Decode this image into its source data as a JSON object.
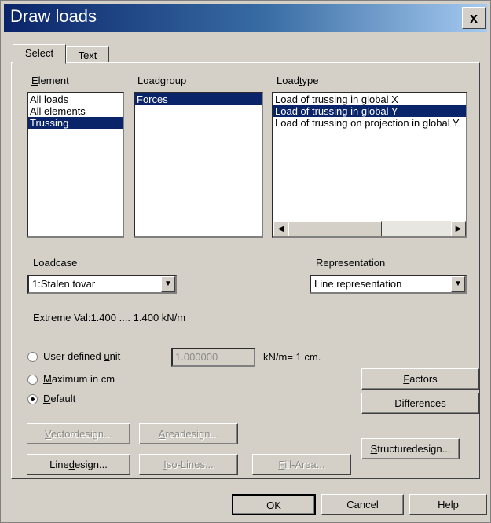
{
  "window": {
    "title": "Draw loads",
    "close_label": "x"
  },
  "tabs": [
    {
      "label": "Select",
      "active": true
    },
    {
      "label": "Text",
      "active": false
    }
  ],
  "element": {
    "label": "Element",
    "items": [
      {
        "label": "All loads",
        "selected": false
      },
      {
        "label": "All elements",
        "selected": false
      },
      {
        "label": "Trussing",
        "selected": true
      }
    ]
  },
  "loadgroup": {
    "label": "Loadgroup",
    "items": [
      {
        "label": "Forces",
        "selected": true
      }
    ]
  },
  "loadtype": {
    "label": "Loadtype",
    "items": [
      {
        "label": "Load of trussing in global X",
        "selected": false
      },
      {
        "label": "Load of trussing in global Y",
        "selected": true
      },
      {
        "label": "Load of trussing on projection in global Y",
        "selected": false
      }
    ],
    "scroll_left_icon": "left-arrow-icon",
    "scroll_right_icon": "right-arrow-icon"
  },
  "loadcase": {
    "label": "Loadcase",
    "value": "1:Stalen tovar"
  },
  "representation": {
    "label": "Representation",
    "value": "Line representation"
  },
  "extreme_text": "Extreme Val:1.400 .... 1.400  kN/m",
  "scale": {
    "options": [
      {
        "label": "User defined unit",
        "checked": false
      },
      {
        "label": "Maximum in cm",
        "checked": false
      },
      {
        "label": "Default",
        "checked": true
      }
    ],
    "unit_value": "1.000000",
    "unit_suffix": "kN/m= 1 cm."
  },
  "buttons": {
    "factors": "Factors",
    "differences": "Differences",
    "vectordesign": "Vectordesign...",
    "areadesign": "Areadesign...",
    "linedesign": "Linedesign...",
    "isolines": "Iso-Lines...",
    "fillarea": "Fill-Area...",
    "structuredesign": "Structuredesign...",
    "ok": "OK",
    "cancel": "Cancel",
    "help": "Help"
  },
  "colors": {
    "selection": "#0a246a",
    "face": "#d4d0c8",
    "title_start": "#0a246a",
    "title_end": "#a6caf0"
  }
}
